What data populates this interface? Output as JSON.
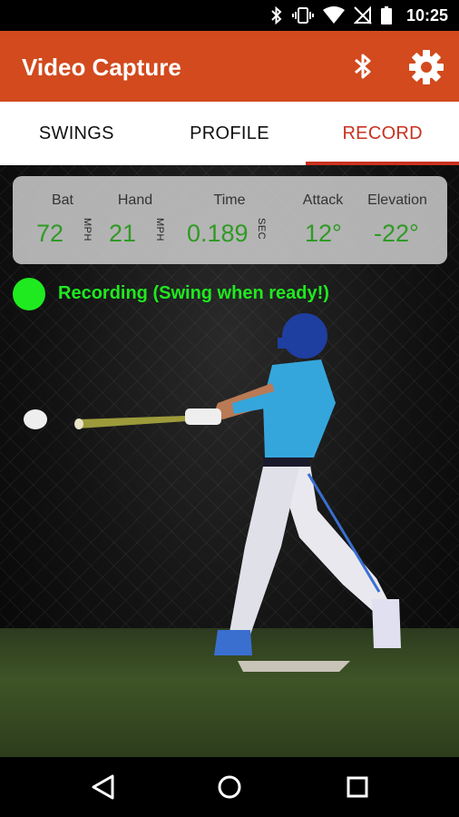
{
  "status_bar": {
    "time": "10:25",
    "icons": [
      "bluetooth-icon",
      "vibrate-icon",
      "wifi-icon",
      "no-signal-icon",
      "battery-icon"
    ]
  },
  "app_bar": {
    "title": "Video Capture",
    "actions": [
      "bluetooth-icon",
      "gear-icon"
    ],
    "color": "#d24a1e"
  },
  "tabs": [
    {
      "label": "SWINGS",
      "active": false
    },
    {
      "label": "PROFILE",
      "active": false
    },
    {
      "label": "RECORD",
      "active": true
    }
  ],
  "stats": {
    "bat": {
      "label": "Bat",
      "value": "72",
      "unit": "MPH"
    },
    "hand": {
      "label": "Hand",
      "value": "21",
      "unit": "MPH"
    },
    "time": {
      "label": "Time",
      "value": "0.189",
      "unit": "SEC"
    },
    "attack": {
      "label": "Attack",
      "value": "12°"
    },
    "elevation": {
      "label": "Elevation",
      "value": "-22°"
    }
  },
  "recording": {
    "text": "Recording (Swing when ready!)",
    "color": "#1fea1f"
  },
  "nav_bar": {
    "buttons": [
      "back-icon",
      "home-icon",
      "recents-icon"
    ]
  }
}
